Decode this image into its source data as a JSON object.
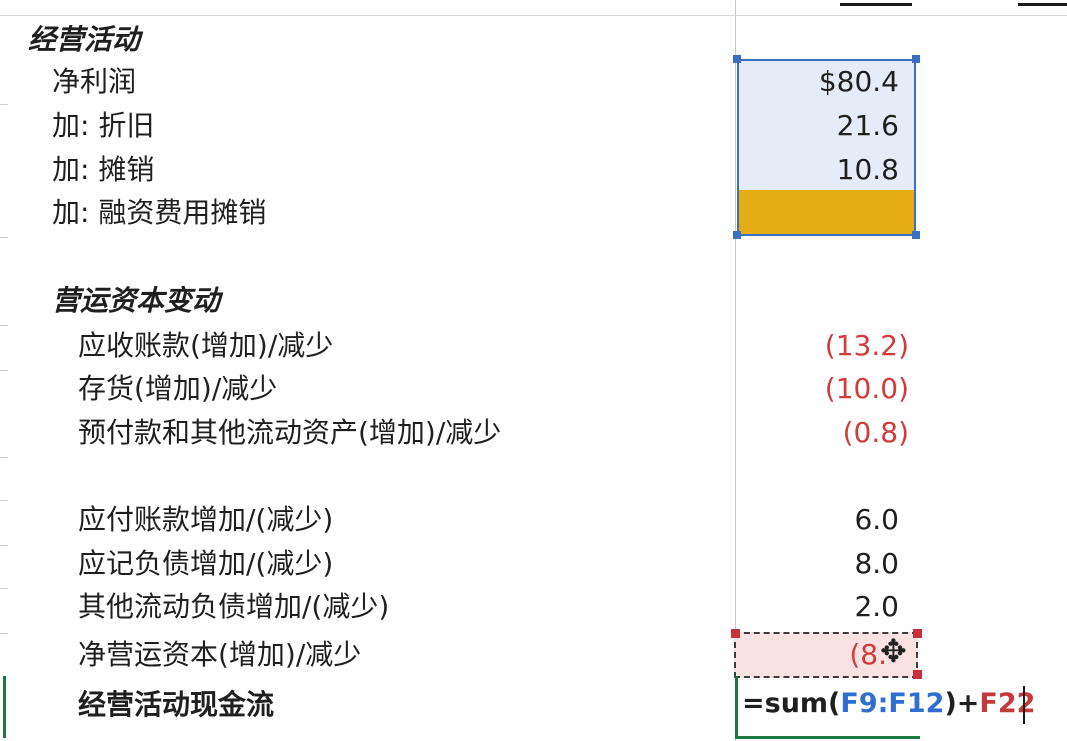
{
  "section_operating": "经营活动",
  "rows_top": [
    {
      "label": "净利润",
      "value": "$80.4"
    },
    {
      "label": "加: 折旧",
      "value": "21.6"
    },
    {
      "label": "加: 摊销",
      "value": "10.8"
    },
    {
      "label": "加: 融资费用摊销",
      "value": ""
    }
  ],
  "section_working_capital": "营运资本变动",
  "rows_assets": [
    {
      "label": "应收账款(增加)/减少",
      "value": "(13.2)"
    },
    {
      "label": "存货(增加)/减少",
      "value": "(10.0)"
    },
    {
      "label": "预付款和其他流动资产(增加)/减少",
      "value": "(0.8)"
    }
  ],
  "rows_liabilities": [
    {
      "label": "应付账款增加/(减少)",
      "value": "6.0"
    },
    {
      "label": "应记负债增加/(减少)",
      "value": "8.0"
    },
    {
      "label": "其他流动负债增加/(减少)",
      "value": "2.0"
    }
  ],
  "net_working_capital": {
    "label": "净营运资本(增加)/减少",
    "value": "(8."
  },
  "operating_cash_flow": {
    "label": "经营活动现金流"
  },
  "formula": {
    "prefix": "=sum(",
    "ref1": "F9:F12",
    "mid": ")+",
    "ref2": "F22"
  },
  "colors": {
    "selection": "#3a6fc4",
    "highlight_fill": "#e5ac14",
    "negative": "#d33b3b",
    "ref1": "#2f6fd0",
    "ref2": "#c43a3a"
  }
}
